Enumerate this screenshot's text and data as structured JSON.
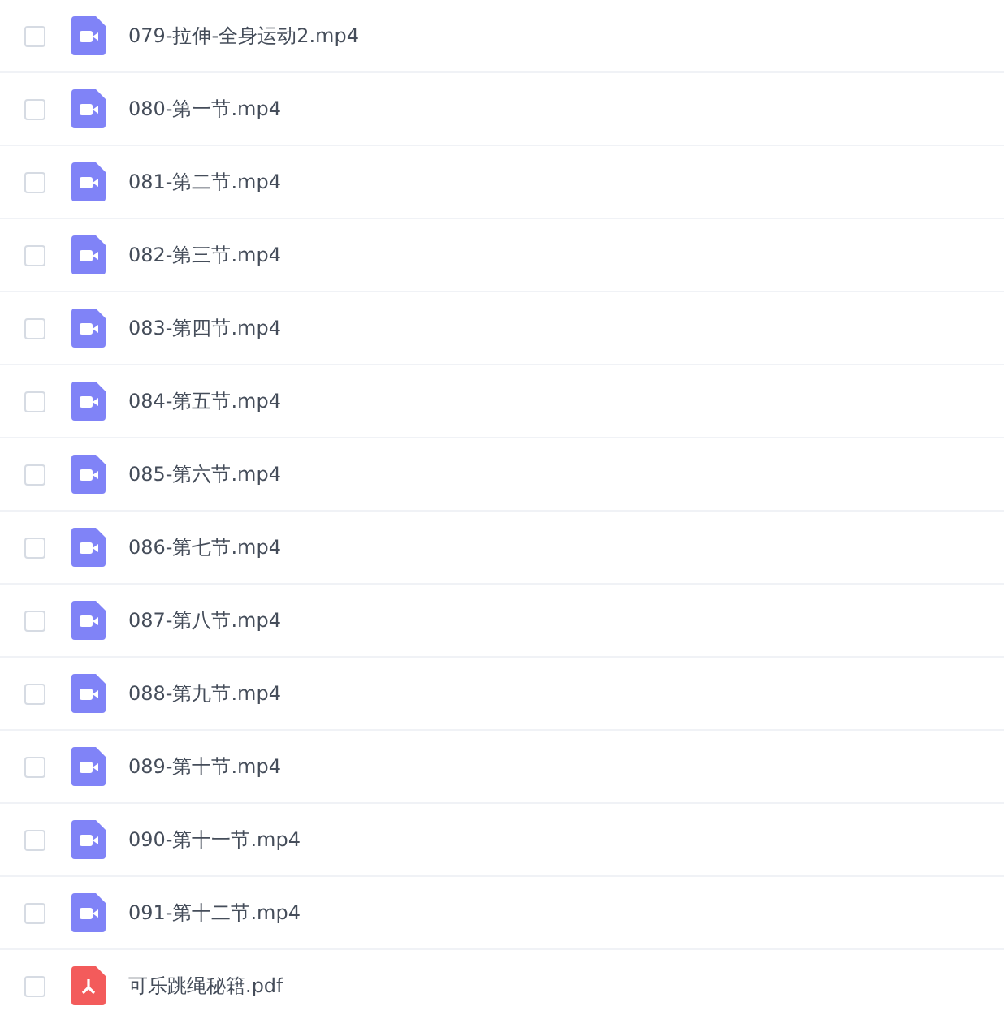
{
  "files": [
    {
      "name": "079-拉伸-全身运动2.mp4",
      "kind": "video",
      "checked": false
    },
    {
      "name": "080-第一节.mp4",
      "kind": "video",
      "checked": false
    },
    {
      "name": "081-第二节.mp4",
      "kind": "video",
      "checked": false
    },
    {
      "name": "082-第三节.mp4",
      "kind": "video",
      "checked": false
    },
    {
      "name": "083-第四节.mp4",
      "kind": "video",
      "checked": false
    },
    {
      "name": "084-第五节.mp4",
      "kind": "video",
      "checked": false
    },
    {
      "name": "085-第六节.mp4",
      "kind": "video",
      "checked": false
    },
    {
      "name": "086-第七节.mp4",
      "kind": "video",
      "checked": false
    },
    {
      "name": "087-第八节.mp4",
      "kind": "video",
      "checked": false
    },
    {
      "name": "088-第九节.mp4",
      "kind": "video",
      "checked": false
    },
    {
      "name": "089-第十节.mp4",
      "kind": "video",
      "checked": false
    },
    {
      "name": "090-第十一节.mp4",
      "kind": "video",
      "checked": false
    },
    {
      "name": "091-第十二节.mp4",
      "kind": "video",
      "checked": false
    },
    {
      "name": "可乐跳绳秘籍.pdf",
      "kind": "pdf",
      "checked": false
    }
  ]
}
